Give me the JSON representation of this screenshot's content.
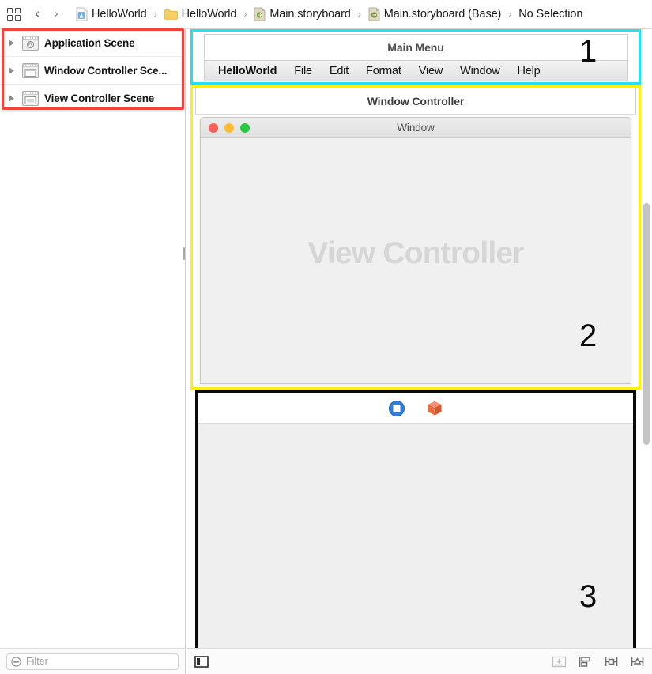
{
  "breadcrumb": {
    "grid_icon": "grid-icon",
    "back_arrow": "‹",
    "forward_arrow": "›",
    "separator": "›",
    "items": [
      {
        "label": "HelloWorld",
        "icon": "xcode-project-icon"
      },
      {
        "label": "HelloWorld",
        "icon": "folder-icon"
      },
      {
        "label": "Main.storyboard",
        "icon": "storyboard-file-icon"
      },
      {
        "label": "Main.storyboard (Base)",
        "icon": "storyboard-file-icon"
      },
      {
        "label": "No Selection",
        "icon": "none"
      }
    ]
  },
  "sidebar": {
    "scenes": [
      {
        "label": "Application Scene",
        "icon": "scene-app-icon"
      },
      {
        "label": "Window Controller Sce...",
        "icon": "scene-window-icon"
      },
      {
        "label": "View Controller Scene",
        "icon": "scene-view-icon"
      }
    ],
    "filter": {
      "placeholder": "Filter",
      "value": "",
      "icon": "filter-icon"
    }
  },
  "canvas": {
    "menu_scene": {
      "title": "Main Menu",
      "index": "1",
      "menu_items": [
        "HelloWorld",
        "File",
        "Edit",
        "Format",
        "View",
        "Window",
        "Help"
      ],
      "app_menu_item": "HelloWorld"
    },
    "window_controller_scene": {
      "title": "Window Controller",
      "index": "2",
      "window_title": "Window",
      "watermark": "View Controller",
      "traffic_lights": [
        "close-red",
        "minimize-yellow",
        "zoom-green"
      ]
    },
    "view_controller_scene": {
      "index": "3",
      "dock_icons": [
        "view-controller-icon",
        "first-responder-icon"
      ]
    }
  },
  "bottom_bar": {
    "left_button": "show-document-outline-icon",
    "right_buttons": [
      "embed-in-icon",
      "align-icon",
      "add-constraints-icon",
      "resolve-autolayout-icon"
    ]
  },
  "highlights": {
    "red": "#f4433b",
    "cyan": "#23e0f5",
    "yellow": "#ffee1a",
    "black": "#0a0a0a"
  }
}
